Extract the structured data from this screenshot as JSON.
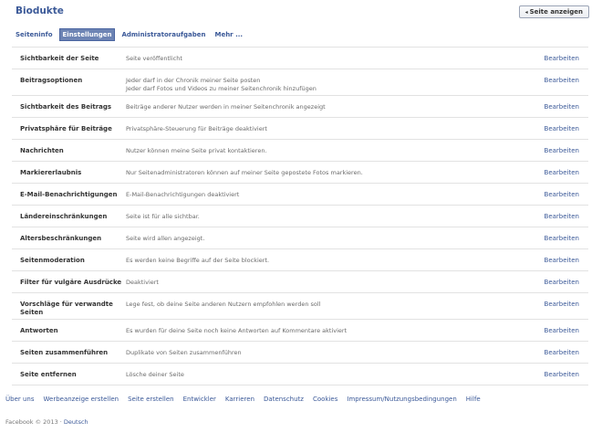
{
  "page": {
    "title": "Biodukte",
    "view_button": "Seite anzeigen",
    "view_button_icon": "arrow-left-icon"
  },
  "tabs": [
    {
      "label": "Seiteninfo",
      "active": false
    },
    {
      "label": "Einstellungen",
      "active": true
    },
    {
      "label": "Administratoraufgaben",
      "active": false
    },
    {
      "label": "Mehr ...",
      "active": false
    }
  ],
  "settings": [
    {
      "label": "Sichtbarkeit der Seite",
      "values": [
        "Seite veröffentlicht"
      ],
      "edit": "Bearbeiten"
    },
    {
      "label": "Beitragsoptionen",
      "values": [
        "Jeder darf in der Chronik meiner Seite posten",
        "Jeder darf Fotos und Videos zu meiner Seitenchronik hinzufügen"
      ],
      "edit": "Bearbeiten"
    },
    {
      "label": "Sichtbarkeit des Beitrags",
      "values": [
        "Beiträge anderer Nutzer werden in meiner Seitenchronik angezeigt"
      ],
      "edit": "Bearbeiten"
    },
    {
      "label": "Privatsphäre für Beiträge",
      "values": [
        "Privatsphäre-Steuerung für Beiträge deaktiviert"
      ],
      "edit": "Bearbeiten"
    },
    {
      "label": "Nachrichten",
      "values": [
        "Nutzer können meine Seite privat kontaktieren."
      ],
      "edit": "Bearbeiten"
    },
    {
      "label": "Markiererlaubnis",
      "values": [
        "Nur Seitenadministratoren können auf meiner Seite gepostete Fotos markieren."
      ],
      "edit": "Bearbeiten"
    },
    {
      "label": "E-Mail-Benachrichtigungen",
      "values": [
        "E-Mail-Benachrichtigungen deaktiviert"
      ],
      "edit": "Bearbeiten"
    },
    {
      "label": "Ländereinschränkungen",
      "values": [
        "Seite ist für alle sichtbar."
      ],
      "edit": "Bearbeiten"
    },
    {
      "label": "Altersbeschränkungen",
      "values": [
        "Seite wird allen angezeigt."
      ],
      "edit": "Bearbeiten"
    },
    {
      "label": "Seitenmoderation",
      "values": [
        "Es werden keine Begriffe auf der Seite blockiert."
      ],
      "edit": "Bearbeiten"
    },
    {
      "label": "Filter für vulgäre Ausdrücke",
      "values": [
        "Deaktiviert"
      ],
      "edit": "Bearbeiten"
    },
    {
      "label": "Vorschläge für verwandte Seiten",
      "values": [
        "Lege fest, ob deine Seite anderen Nutzern empfohlen werden soll"
      ],
      "edit": "Bearbeiten"
    },
    {
      "label": "Antworten",
      "values": [
        "Es wurden für deine Seite noch keine Antworten auf Kommentare aktiviert"
      ],
      "edit": "Bearbeiten"
    },
    {
      "label": "Seiten zusammenführen",
      "values": [
        "Duplikate von Seiten zusammenführen"
      ],
      "edit": "Bearbeiten"
    },
    {
      "label": "Seite entfernen",
      "values": [
        "Lösche deiner Seite"
      ],
      "edit": "Bearbeiten"
    }
  ],
  "footer": {
    "links": [
      "Über uns",
      "Werbeanzeige erstellen",
      "Seite erstellen",
      "Entwickler",
      "Karrieren",
      "Datenschutz",
      "Cookies",
      "Impressum/Nutzungsbedingungen",
      "Hilfe"
    ],
    "copyright": "Facebook © 2013 · ",
    "language": "Deutsch"
  }
}
